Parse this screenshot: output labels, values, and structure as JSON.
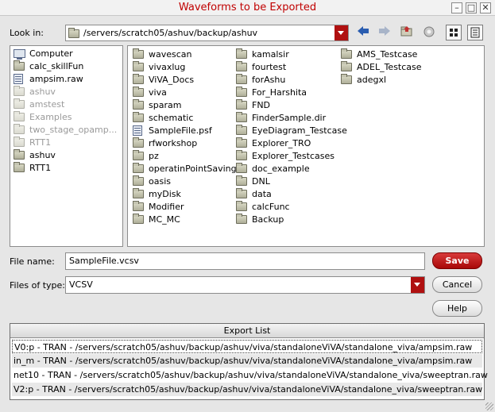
{
  "window": {
    "title": "Waveforms to be Exported",
    "minimize": "–",
    "maximize": "□",
    "close": "✕"
  },
  "toolbar": {
    "look_in_label": "Look in:",
    "look_in_path": "/servers/scratch05/ashuv/backup/ashuv",
    "icons": [
      "back-icon",
      "forward-icon",
      "parent-folder-icon",
      "new-folder-icon",
      "list-view-icon",
      "detail-view-icon"
    ]
  },
  "sidebar": {
    "items": [
      {
        "label": "Computer",
        "icon": "computer",
        "dim": false
      },
      {
        "label": "calc_skillFun",
        "icon": "folder",
        "dim": false
      },
      {
        "label": "ampsim.raw",
        "icon": "file",
        "dim": false
      },
      {
        "label": "ashuv",
        "icon": "folder",
        "dim": true
      },
      {
        "label": "amstest",
        "icon": "folder",
        "dim": true
      },
      {
        "label": "Examples",
        "icon": "folder",
        "dim": true
      },
      {
        "label": "two_stage_opamp...",
        "icon": "folder",
        "dim": true
      },
      {
        "label": "RTT1",
        "icon": "folder",
        "dim": true
      },
      {
        "label": "ashuv",
        "icon": "folder",
        "dim": false
      },
      {
        "label": "RTT1",
        "icon": "folder",
        "dim": false
      }
    ]
  },
  "files": {
    "columns": [
      [
        {
          "label": "wavescan",
          "icon": "folder"
        },
        {
          "label": "vivaxlug",
          "icon": "folder"
        },
        {
          "label": "ViVA_Docs",
          "icon": "folder"
        },
        {
          "label": "viva",
          "icon": "folder"
        },
        {
          "label": "sparam",
          "icon": "folder"
        },
        {
          "label": "schematic",
          "icon": "folder"
        },
        {
          "label": "SampleFile.psf",
          "icon": "file"
        },
        {
          "label": "rfworkshop",
          "icon": "folder"
        },
        {
          "label": "pz",
          "icon": "folder"
        },
        {
          "label": "operatinPointSaving",
          "icon": "folder"
        },
        {
          "label": "oasis",
          "icon": "folder"
        },
        {
          "label": "myDisk",
          "icon": "folder"
        },
        {
          "label": "Modifier",
          "icon": "folder"
        },
        {
          "label": "MC_MC",
          "icon": "folder"
        }
      ],
      [
        {
          "label": "kamalsir",
          "icon": "folder"
        },
        {
          "label": "fourtest",
          "icon": "folder"
        },
        {
          "label": "forAshu",
          "icon": "folder"
        },
        {
          "label": "For_Harshita",
          "icon": "folder"
        },
        {
          "label": "FND",
          "icon": "folder"
        },
        {
          "label": "FinderSample.dir",
          "icon": "folder"
        },
        {
          "label": "EyeDiagram_Testcase",
          "icon": "folder"
        },
        {
          "label": "Explorer_TRO",
          "icon": "folder"
        },
        {
          "label": "Explorer_Testcases",
          "icon": "folder"
        },
        {
          "label": "doc_example",
          "icon": "folder"
        },
        {
          "label": "DNL",
          "icon": "folder"
        },
        {
          "label": "data",
          "icon": "folder"
        },
        {
          "label": "calcFunc",
          "icon": "folder"
        },
        {
          "label": "Backup",
          "icon": "folder"
        }
      ],
      [
        {
          "label": "AMS_Testcase",
          "icon": "folder"
        },
        {
          "label": "ADEL_Testcase",
          "icon": "folder"
        },
        {
          "label": "adegxl",
          "icon": "folder"
        }
      ]
    ]
  },
  "form": {
    "file_name_label": "File name:",
    "file_name_value": "SampleFile.vcsv",
    "file_type_label": "Files of type:",
    "file_type_value": "VCSV",
    "save_label": "Save",
    "cancel_label": "Cancel",
    "help_label": "Help"
  },
  "export_list": {
    "header": "Export List",
    "rows": [
      "V0:p - TRAN - /servers/scratch05/ashuv/backup/ashuv/viva/standaloneViVA/standalone_viva/ampsim.raw",
      "in_m - TRAN - /servers/scratch05/ashuv/backup/ashuv/viva/standaloneViVA/standalone_viva/ampsim.raw",
      "net10 - TRAN - /servers/scratch05/ashuv/backup/ashuv/viva/standaloneViVA/standalone_viva/sweeptran.raw",
      "V2:p - TRAN - /servers/scratch05/ashuv/backup/ashuv/viva/standaloneViVA/standalone_viva/sweeptran.raw"
    ]
  },
  "colors": {
    "title_text": "#c00000",
    "accent_red": "#b01010",
    "nav_blue": "#2a5db0"
  }
}
